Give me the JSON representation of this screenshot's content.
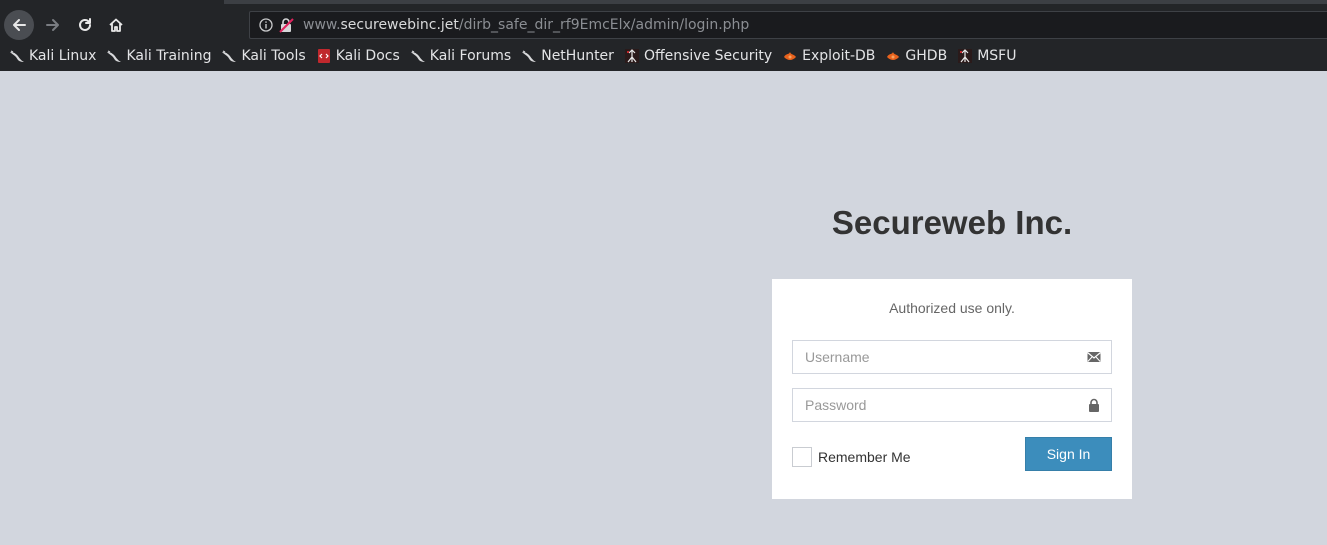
{
  "browser": {
    "url_prefix": "www.",
    "url_host": "securewebinc.jet",
    "url_path": "/dirb_safe_dir_rf9EmcElx/admin/login.php",
    "bookmarks": [
      {
        "label": "Kali Linux",
        "icon": "kali-dragon-icon"
      },
      {
        "label": "Kali Training",
        "icon": "kali-dragon-icon"
      },
      {
        "label": "Kali Tools",
        "icon": "kali-dragon-icon"
      },
      {
        "label": "Kali Docs",
        "icon": "kali-docs-icon"
      },
      {
        "label": "Kali Forums",
        "icon": "kali-dragon-icon"
      },
      {
        "label": "NetHunter",
        "icon": "kali-dragon-icon"
      },
      {
        "label": "Offensive Security",
        "icon": "offsec-icon"
      },
      {
        "label": "Exploit-DB",
        "icon": "exploit-db-icon"
      },
      {
        "label": "GHDB",
        "icon": "exploit-db-icon"
      },
      {
        "label": "MSFU",
        "icon": "offsec-icon"
      }
    ]
  },
  "page": {
    "brand": "Secureweb Inc.",
    "message": "Authorized use only.",
    "username_placeholder": "Username",
    "password_placeholder": "Password",
    "remember_label": "Remember Me",
    "signin_label": "Sign In",
    "accent_color": "#3c8dbc",
    "background_color": "#d2d6de"
  }
}
